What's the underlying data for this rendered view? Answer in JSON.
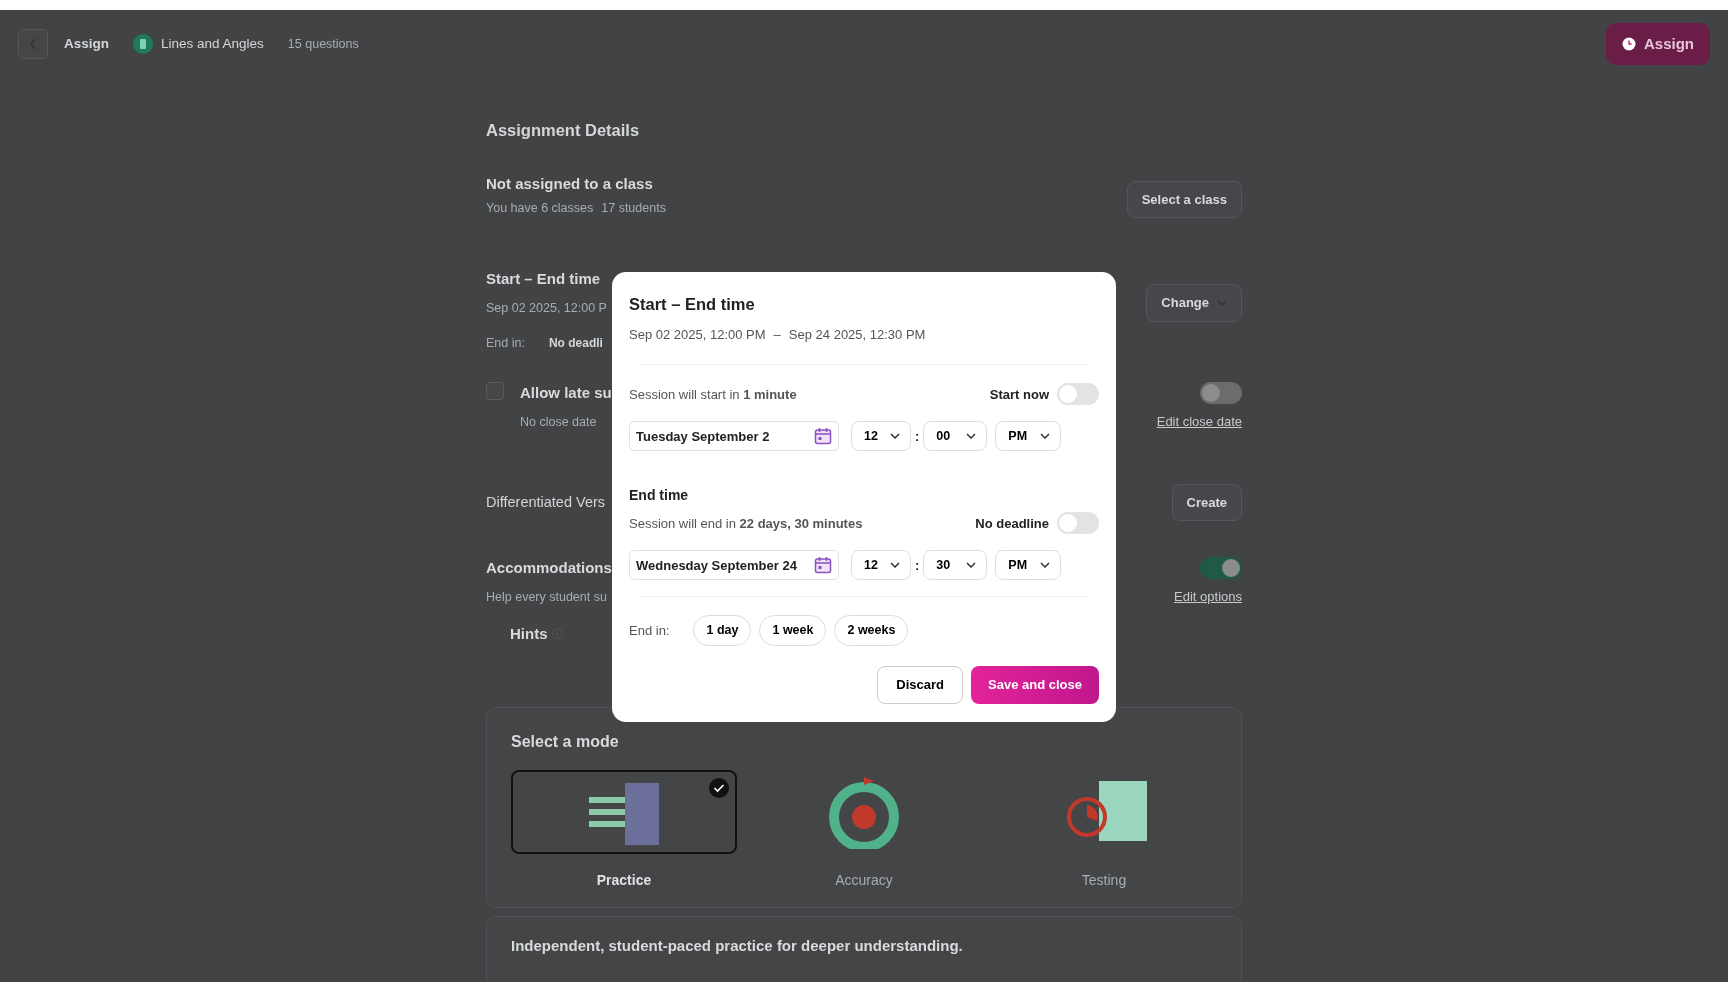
{
  "top_bar": {
    "title": "Assign",
    "quiz_name": "Lines and Angles",
    "quiz_count": "15 questions",
    "assign_button": "Assign"
  },
  "details": {
    "heading": "Assignment Details",
    "class_section": {
      "title": "Not assigned to a class",
      "subtitle": "You have 6 classes",
      "count": "17 students",
      "button": "Select a class"
    },
    "time_section": {
      "title": "Start – End time",
      "range": "Sep 02 2025, 12:00 P",
      "end_label": "End in:",
      "end_value": "No deadli",
      "button": "Change"
    },
    "late_section": {
      "title": "Allow late su",
      "subtitle": "No close date",
      "checked": false,
      "on": false,
      "link": "Edit close date"
    },
    "diff_section": {
      "title": "Differentiated Vers",
      "button": "Create"
    },
    "accommodations": {
      "title": "Accommodations",
      "subtitle": "Help every student su",
      "on": true,
      "link": "Edit options",
      "items": [
        {
          "label": "Hints"
        }
      ]
    }
  },
  "modes": {
    "title": "Select a mode",
    "items": [
      {
        "kind": "practice",
        "label": "Practice",
        "selected": true
      },
      {
        "kind": "accuracy",
        "label": "Accuracy",
        "selected": false
      },
      {
        "kind": "testing",
        "label": "Testing",
        "selected": false
      }
    ],
    "description": "Independent, student-paced practice for deeper understanding."
  },
  "modal": {
    "title": "Start – End time",
    "range_start": "Sep 02 2025, 12:00 PM",
    "range_sep": "–",
    "range_end": "Sep 24 2025, 12:30 PM",
    "start": {
      "status": "Session will start in **1 minute**",
      "toggle_label": "Start now",
      "on": false,
      "date": "Tuesday September 2",
      "hour": "12",
      "minute": "00",
      "period": "PM"
    },
    "end": {
      "heading": "End time",
      "status": "Session will end in **22 days, 30 minutes**",
      "toggle_label": "No deadline",
      "on": false,
      "date": "Wednesday September 24",
      "hour": "12",
      "minute": "30",
      "period": "PM"
    },
    "separator": ":",
    "end_in_label": "End in:",
    "presets": [
      "1 day",
      "1 week",
      "2 weeks"
    ],
    "buttons": {
      "discard": "Discard",
      "save": "Save and close"
    }
  }
}
